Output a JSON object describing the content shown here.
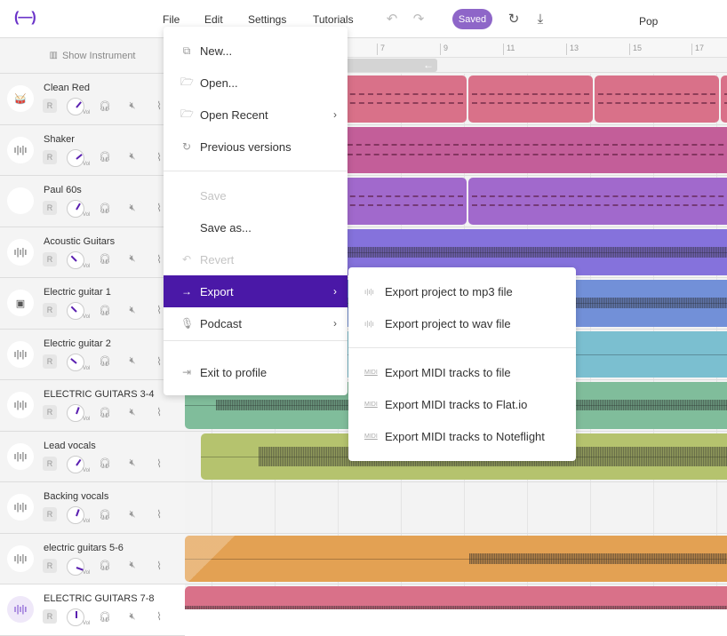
{
  "app": {
    "logo": "(—)",
    "project_name": "Pop",
    "save_status": "Saved"
  },
  "menubar": {
    "items": [
      {
        "label": "File"
      },
      {
        "label": "Edit"
      },
      {
        "label": "Settings"
      },
      {
        "label": "Tutorials"
      }
    ],
    "undo_icon": "undo-icon",
    "redo_icon": "redo-icon",
    "history_icon": "history-icon",
    "download_icon": "download-icon"
  },
  "left_pane": {
    "show_instrument_label": "Show Instrument",
    "tracks": [
      {
        "name": "Clean Red",
        "icon": "drum-icon",
        "glyph": "🥁",
        "record": "R",
        "vol_label": "Vol",
        "vol_angle": 40
      },
      {
        "name": "Shaker",
        "icon": "waveform-icon",
        "glyph": "ı|ı|ı",
        "record": "R",
        "vol_label": "Vol",
        "vol_angle": 50
      },
      {
        "name": "Paul 60s",
        "icon": "none",
        "glyph": "",
        "record": "R",
        "vol_label": "Vol",
        "vol_angle": 30
      },
      {
        "name": "Acoustic Guitars",
        "icon": "waveform-icon",
        "glyph": "ı|ı|ı",
        "record": "R",
        "vol_label": "Vol",
        "vol_angle": -45
      },
      {
        "name": "Electric guitar 1",
        "icon": "amp-icon",
        "glyph": "▣",
        "record": "R",
        "vol_label": "Vol",
        "vol_angle": -45
      },
      {
        "name": "Electric guitar 2",
        "icon": "waveform-icon",
        "glyph": "ı|ı|ı",
        "record": "R",
        "vol_label": "Vol",
        "vol_angle": -50
      },
      {
        "name": "ELECTRIC GUITARS 3-4",
        "icon": "waveform-icon",
        "glyph": "ı|ı|ı",
        "record": "R",
        "vol_label": "Vol",
        "vol_angle": 20
      },
      {
        "name": "Lead vocals",
        "icon": "waveform-icon",
        "glyph": "ı|ı|ı",
        "record": "R",
        "vol_label": "Vol",
        "vol_angle": 35
      },
      {
        "name": "Backing vocals",
        "icon": "waveform-icon",
        "glyph": "ı|ı|ı",
        "record": "R",
        "vol_label": "Vol",
        "vol_angle": 20
      },
      {
        "name": "electric guitars 5-6",
        "icon": "waveform-icon",
        "glyph": "ı|ı|ı",
        "record": "R",
        "vol_label": "Vol",
        "vol_angle": 110
      },
      {
        "name": "ELECTRIC GUITARS 7-8",
        "icon": "waveform-icon",
        "glyph": "ı|ı|ı",
        "record": "R",
        "vol_label": "Vol",
        "vol_angle": 0,
        "selected": true
      }
    ],
    "controls": {
      "solo_icon": "headphones-icon",
      "mute_icon": "mute-icon",
      "automation_icon": "automation-icon"
    }
  },
  "timeline": {
    "ruler_ticks": [
      "7",
      "9",
      "11",
      "13",
      "15",
      "17"
    ],
    "loop_arrow": "←",
    "lane_colors": [
      "#d97189",
      "#c35e99",
      "#a169cc",
      "#8572dc",
      "#7290d8",
      "#7bbfd0",
      "#80bd9b",
      "#b5c36e",
      "#f3f3f3",
      "#e3a153",
      "#d97189"
    ]
  },
  "file_menu": {
    "items": [
      {
        "label": "New...",
        "icon": "new-copy-icon",
        "glyph": "⧉"
      },
      {
        "label": "Open...",
        "icon": "folder-open-icon",
        "glyph": "🗁"
      },
      {
        "label": "Open Recent",
        "icon": "folder-open-icon",
        "glyph": "🗁",
        "submenu": true
      },
      {
        "label": "Previous versions",
        "icon": "history-icon",
        "glyph": "↻"
      },
      {
        "label": "Save",
        "disabled": true
      },
      {
        "label": "Save as..."
      },
      {
        "label": "Revert",
        "icon": "revert-icon",
        "glyph": "↶",
        "disabled": true
      },
      {
        "label": "Export",
        "icon": "arrow-right-icon",
        "glyph": "→",
        "submenu": true,
        "active": true
      },
      {
        "label": "Podcast",
        "icon": "microphone-icon",
        "glyph": "🎙",
        "submenu": true
      },
      {
        "label": "Exit to profile",
        "icon": "exit-icon",
        "glyph": "⇥"
      }
    ],
    "chevron": "›"
  },
  "export_menu": {
    "items": [
      {
        "label": "Export project to mp3 file",
        "icon": "waveform-icon",
        "glyph": "ı|ı|ı"
      },
      {
        "label": "Export project to wav file",
        "icon": "waveform-icon",
        "glyph": "ı|ı|ı"
      },
      {
        "label": "Export MIDI tracks to file",
        "icon": "midi-icon",
        "glyph": "MIDI"
      },
      {
        "label": "Export MIDI tracks to Flat.io",
        "icon": "midi-icon",
        "glyph": "MIDI"
      },
      {
        "label": "Export MIDI tracks to Noteflight",
        "icon": "midi-icon",
        "glyph": "MIDI"
      }
    ]
  },
  "colors": {
    "accent": "#4a18a7",
    "saved_badge": "#8e66c8",
    "logo": "#6a33c9"
  }
}
